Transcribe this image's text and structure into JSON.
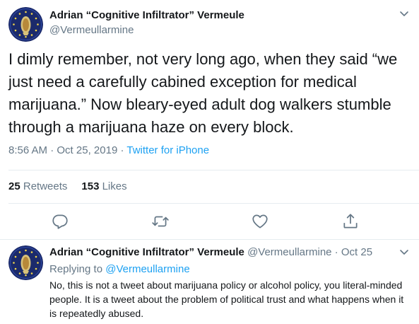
{
  "tweet": {
    "author_name": "Adrian “Cognitive Infiltrator” Vermeule",
    "author_handle": "@Vermeullarmine",
    "text": "I dimly remember, not very long ago, when they said “we just need a carefully cabined exception for medical marijuana.” Now bleary-eyed adult dog walkers stumble through a marijuana haze on every block.",
    "time": "8:56 AM",
    "separator": " · ",
    "date": "Oct 25, 2019",
    "source": "Twitter for iPhone",
    "retweets_count": "25",
    "retweets_label": "Retweets",
    "likes_count": "153",
    "likes_label": "Likes"
  },
  "actions": {
    "reply_icon": "reply-icon",
    "retweet_icon": "retweet-icon",
    "like_icon": "heart-icon",
    "share_icon": "share-icon"
  },
  "reply": {
    "author_name": "Adrian “Cognitive Infiltrator” Vermeule",
    "author_handle": "@Vermeullarmine",
    "date": "Oct 25",
    "replying_prefix": "Replying to ",
    "replying_to": "@Vermeullarmine",
    "text": "No, this is not a tweet about marijuana policy or alcohol policy, you literal-minded people. It is a tweet about the problem of political trust and what happens when it is repeatedly abused."
  },
  "colors": {
    "accent": "#1da1f2",
    "secondary_text": "#657786",
    "primary_text": "#14171a",
    "avatar_bg": "#1b2a6b",
    "avatar_ring": "#c9a227"
  }
}
